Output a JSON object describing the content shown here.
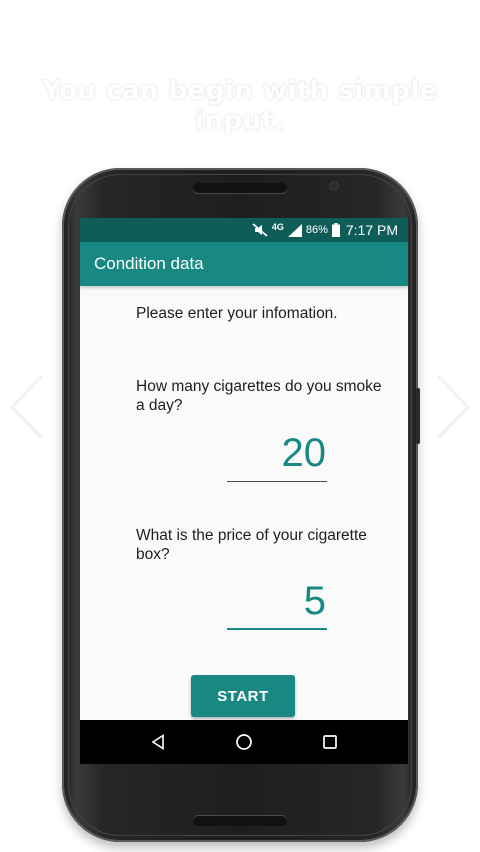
{
  "headline": "You can begin with simple input.",
  "status_bar": {
    "network": "4G",
    "battery_percent": "86%",
    "time": "7:17 PM",
    "icons": [
      "mute-icon",
      "signal-icon",
      "battery-icon"
    ]
  },
  "app_bar": {
    "title": "Condition data"
  },
  "form": {
    "intro": "Please enter your infomation.",
    "question_cigarettes": "How many cigarettes do you smoke a day?",
    "cigarettes_value": "20",
    "question_price": "What is the price of your cigarette box?",
    "price_value": "5",
    "start_label": "START"
  },
  "nav_bar": {
    "icons": [
      "back-icon",
      "home-icon",
      "recents-icon"
    ]
  },
  "colors": {
    "primary": "#188982",
    "primary_dark": "#0f5d58",
    "background": "#fafafa",
    "text": "#1e1e1e"
  }
}
